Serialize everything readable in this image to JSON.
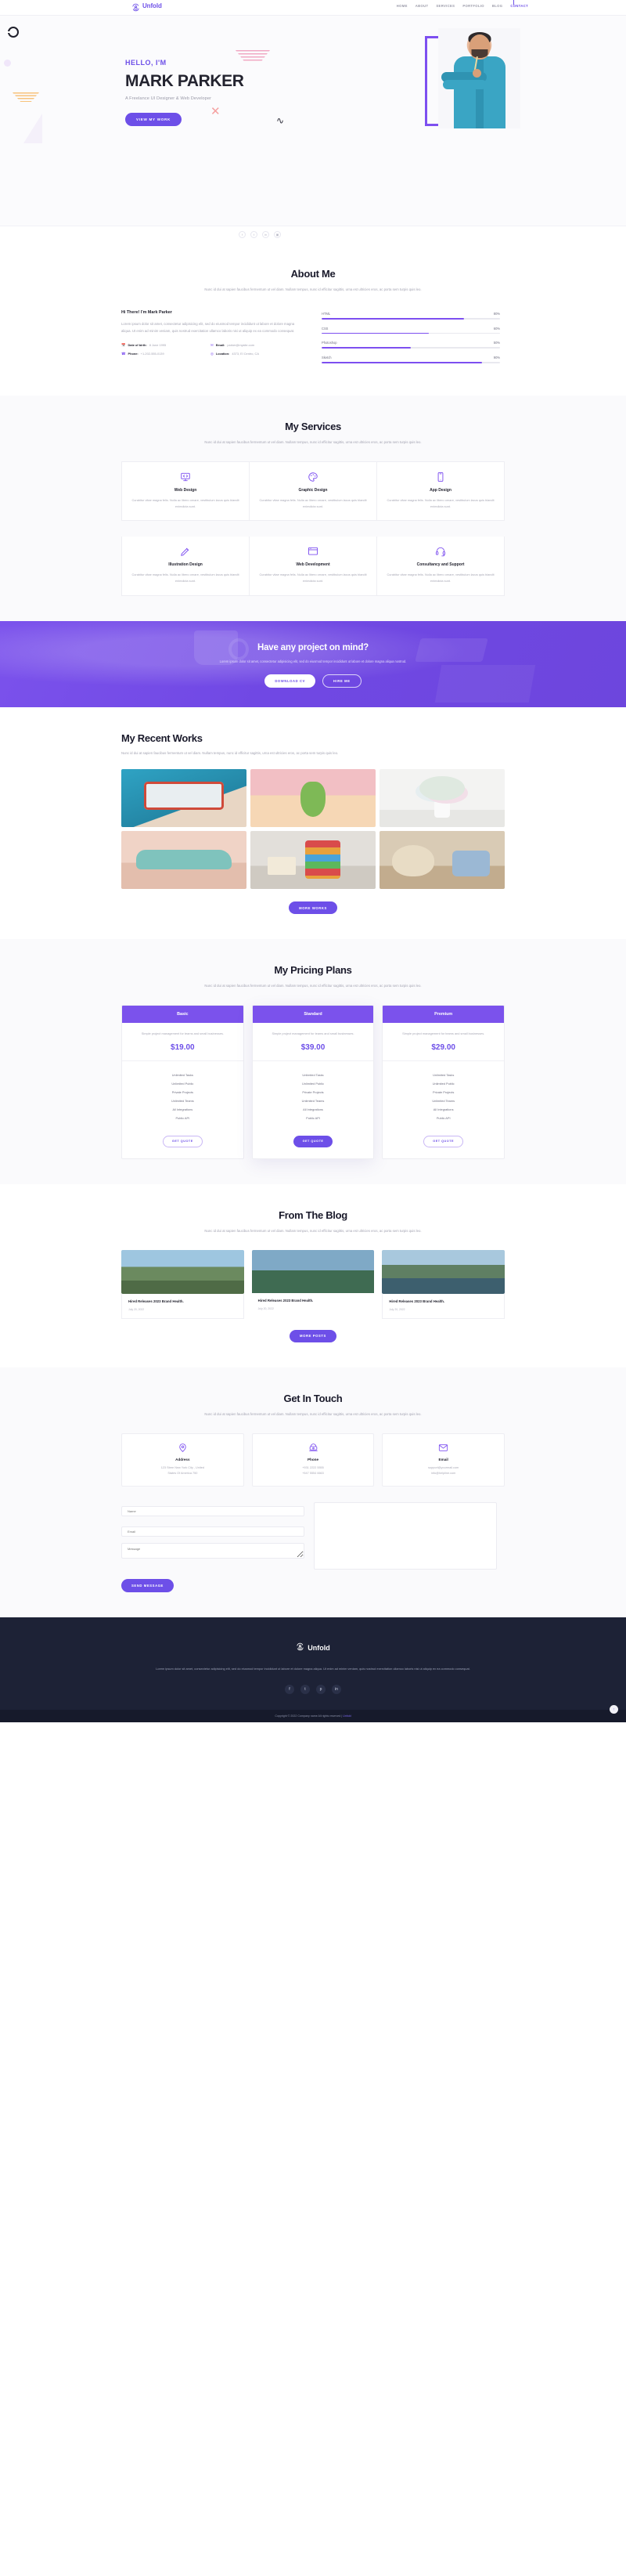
{
  "brand": {
    "name": "Unfold",
    "logo_icon": "unfold-logo-icon"
  },
  "nav": {
    "items": [
      {
        "label": "HOME",
        "active": false
      },
      {
        "label": "ABOUT",
        "active": false
      },
      {
        "label": "SERVICES",
        "active": false
      },
      {
        "label": "PORTFOLIO",
        "active": false
      },
      {
        "label": "BLOG",
        "active": false
      },
      {
        "label": "CONTACT",
        "active": true
      }
    ]
  },
  "hero": {
    "greeting": "HELLO, I'M",
    "name": "MARK PARKER",
    "subtitle": "A Freelance UI Designer & Web Developer",
    "cta_label": "VIEW MY WORK",
    "social": [
      {
        "name": "facebook-icon",
        "glyph": "f"
      },
      {
        "name": "twitter-icon",
        "glyph": "t"
      },
      {
        "name": "linkedin-icon",
        "glyph": "in"
      },
      {
        "name": "instagram-icon",
        "glyph": "▣"
      }
    ]
  },
  "about": {
    "title": "About Me",
    "subtitle": "Nunc id dui at sapien faucibus fermentum ut vel diam. Nullam tempus, nunc id efficitur sagittis, urna est ultricies eros, ac porta sem turpis quis leo.",
    "heading": "Hi There! I'm Mark Parker",
    "paragraph": "Lorem ipsum dolor sit amet, consectetur adipisicing elit, sed do eiusmod tempor incididunt ut labore et dolore magna aliqua. Ut enim ad minim veniam, quis nostrud exercitation ullamco laboris nisi ut aliquip ex ea commodo consequat.",
    "info": [
      {
        "icon": "calendar-icon",
        "label": "Date of birth:",
        "value": "8 June 1995"
      },
      {
        "icon": "mail-icon",
        "label": "Email:",
        "value": "parker@mysite.com"
      },
      {
        "icon": "phone-icon",
        "label": "Phone:",
        "value": "+1-202-555-0139"
      },
      {
        "icon": "location-icon",
        "label": "Location:",
        "value": "4373, El Centro, CA"
      }
    ],
    "skills": [
      {
        "name": "HTML",
        "percent": "80%",
        "value": 80
      },
      {
        "name": "CSS",
        "percent": "60%",
        "value": 60
      },
      {
        "name": "Photoshop",
        "percent": "50%",
        "value": 50
      },
      {
        "name": "Sketch",
        "percent": "90%",
        "value": 90
      }
    ]
  },
  "services": {
    "title": "My Services",
    "subtitle": "Nunc id dui at sapien faucibus fermentum ut vel diam. Nullam tempus, nunc id efficitur sagittis, urna est ultricies eros, ac porta sem turpis quis leo.",
    "items": [
      {
        "icon": "code-monitor-icon",
        "title": "Web Design",
        "text": "Curabitur vitae magna felis. Nulla ac libero ornare, vestibulum lacus quis blandit enimdicta sunt."
      },
      {
        "icon": "palette-icon",
        "title": "Graphic Design",
        "text": "Curabitur vitae magna felis. Nulla ac libero ornare, vestibulum lacus quis blandit enimdicta sunt."
      },
      {
        "icon": "mobile-phone-icon",
        "title": "App Design",
        "text": "Curabitur vitae magna felis. Nulla ac libero ornare, vestibulum lacus quis blandit enimdicta sunt."
      },
      {
        "icon": "pen-ruler-icon",
        "title": "Illustration Design",
        "text": "Curabitur vitae magna felis. Nulla ac libero ornare, vestibulum lacus quis blandit enimdicta sunt."
      },
      {
        "icon": "browser-window-icon",
        "title": "Web Development",
        "text": "Curabitur vitae magna felis. Nulla ac libero ornare, vestibulum lacus quis blandit enimdicta sunt."
      },
      {
        "icon": "headset-support-icon",
        "title": "Consultancy and Support",
        "text": "Curabitur vitae magna felis. Nulla ac libero ornare, vestibulum lacus quis blandit enimdicta sunt."
      }
    ]
  },
  "cta": {
    "title": "Have any project on mind?",
    "text": "Lorem ipsum dolor sit amet, consectetur adipisicing elit, sed do eiusmod tempor incididunt ut labore et dolore magna aliqua nostrud.",
    "primary_label": "DOWNLOAD CV",
    "secondary_label": "HIRE ME"
  },
  "works": {
    "title": "My Recent Works",
    "subtitle": "Nunc id dui at sapien faucibus fermentum ut vel diam. Nullam tempus, nunc id efficitur sagittis, urna est ultricies eros, ac porta sem turpis quis leo.",
    "more_label": "MORE WORKS",
    "items": [
      {
        "name": "toy-train-photo"
      },
      {
        "name": "banana-cactus-photo"
      },
      {
        "name": "white-flowers-vase-photo"
      },
      {
        "name": "vintage-toy-car-photo"
      },
      {
        "name": "alphabet-blocks-rings-photo"
      },
      {
        "name": "teddy-bear-toys-photo"
      }
    ]
  },
  "pricing": {
    "title": "My Pricing Plans",
    "subtitle": "Nunc id dui at sapien faucibus fermentum ut vel diam. Nullam tempus, nunc id efficitur sagittis, urna est ultricies eros, ac porta sem turpis quis leo.",
    "plans": [
      {
        "name": "Basic",
        "desc": "Simple project management for teams and small businesses.",
        "price": "$19.00",
        "features": [
          "Unlimited Tasks",
          "Unlimited Public",
          "Private Projects",
          "Unlimited Teams",
          "All Integrations",
          "Public API"
        ],
        "button": "GET QUOTE",
        "featured": false
      },
      {
        "name": "Standard",
        "desc": "Simple project management for teams and small businesses.",
        "price": "$39.00",
        "features": [
          "Unlimited Tasks",
          "Unlimited Public",
          "Private Projects",
          "Unlimited Teams",
          "All Integrations",
          "Public API"
        ],
        "button": "GET QUOTE",
        "featured": true
      },
      {
        "name": "Premium",
        "desc": "Simple project management for teams and small businesses.",
        "price": "$29.00",
        "features": [
          "Unlimited Tasks",
          "Unlimited Public",
          "Private Projects",
          "Unlimited Teams",
          "All Integrations",
          "Public API"
        ],
        "button": "GET QUOTE",
        "featured": false
      }
    ]
  },
  "blog": {
    "title": "From The Blog",
    "subtitle": "Nunc id dui at sapien faucibus fermentum ut vel diam. Nullam tempus, nunc id efficitur sagittis, urna est ultricies eros, ac porta sem turpis quis leo.",
    "more_label": "MORE POSTS",
    "posts": [
      {
        "image": "mountain-lake-photo",
        "title": "Hired Releases 2023 Brand Health.",
        "date": "July 20, 2022"
      },
      {
        "image": "green-valley-photo",
        "title": "Hired Releases 2023 Brand Health.",
        "date": "July 20, 2022"
      },
      {
        "image": "lakeside-cabins-photo",
        "title": "Hired Releases 2023 Brand Health.",
        "date": "July 20, 2022"
      }
    ]
  },
  "contact": {
    "title": "Get In Touch",
    "subtitle": "Nunc id dui at sapien faucibus fermentum ut vel diam. Nullam tempus, nunc id efficitur sagittis, urna est ultricies eros, ac porta sem turpis quis leo.",
    "cards": [
      {
        "icon": "location-pin-icon",
        "title": "Address",
        "line1": "123 Stree New York City , United",
        "line2": "States Of America 750"
      },
      {
        "icon": "telephone-icon",
        "title": "Phone",
        "line1": "+931 2222 5555",
        "line2": "+547 5554 6663"
      },
      {
        "icon": "envelope-icon",
        "title": "Email",
        "line1": "support@yourmail.com",
        "line2": "info@helpline.com"
      }
    ],
    "form": {
      "name_placeholder": "Name",
      "email_placeholder": "Email",
      "message_placeholder": "Message",
      "submit_label": "SEND MESSAGE"
    }
  },
  "footer": {
    "brand": "Unfold",
    "text": "Lorem ipsum dolor sit amet, consectetur adipisicing elit, sed do eiusmod tempor incididunt ut labore et dolore magna aliqua. Ut enim ad minim veniam, quis nostrud exercitation ullamco laboris nisi ut aliquip ex ea commodo consequat.",
    "social": [
      {
        "name": "facebook-icon",
        "glyph": "f"
      },
      {
        "name": "twitter-icon",
        "glyph": "t"
      },
      {
        "name": "pinterest-icon",
        "glyph": "p"
      },
      {
        "name": "linkedin-icon",
        "glyph": "in"
      }
    ],
    "copyright_prefix": "Copyright © 2022 Company name All rights reserved | ",
    "copyright_link": "Unfold",
    "to_top_icon": "arrow-up-icon"
  },
  "colors": {
    "accent": "#6d4fe8",
    "accent_light": "#7d4ff0",
    "dark": "#1d2236",
    "muted": "#a4a4b2"
  }
}
